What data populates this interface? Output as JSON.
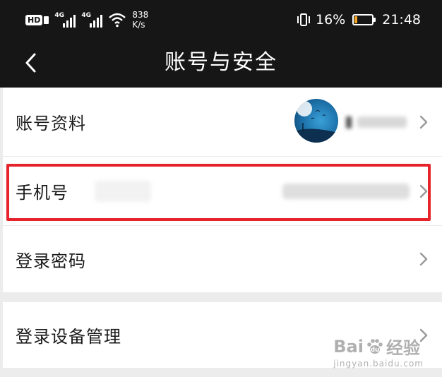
{
  "status_bar": {
    "hd_label": "HD",
    "signal_1_tag": "4G",
    "signal_2_tag": "4G",
    "net_speed_value": "838",
    "net_speed_unit": "K/s",
    "battery_percent": "16%",
    "battery_level": 0.16,
    "battery_color": "#f6a623",
    "time": "21:48",
    "icons": [
      "hd-icon",
      "signal-icon",
      "wifi-icon",
      "vibrate-icon",
      "battery-icon"
    ]
  },
  "nav": {
    "back_icon": "chevron-left-icon",
    "title": "账号与安全"
  },
  "rows": [
    {
      "label": "账号资料",
      "value": ""
    },
    {
      "label": "手机号",
      "value": ""
    },
    {
      "label": "登录密码",
      "value": ""
    },
    {
      "label": "登录设备管理",
      "value": ""
    }
  ],
  "annotation": {
    "highlight_color": "#e6232b"
  },
  "watermark": {
    "brand_left": "Bai",
    "brand_right": "经验",
    "url": "jingyan.baidu.com"
  }
}
